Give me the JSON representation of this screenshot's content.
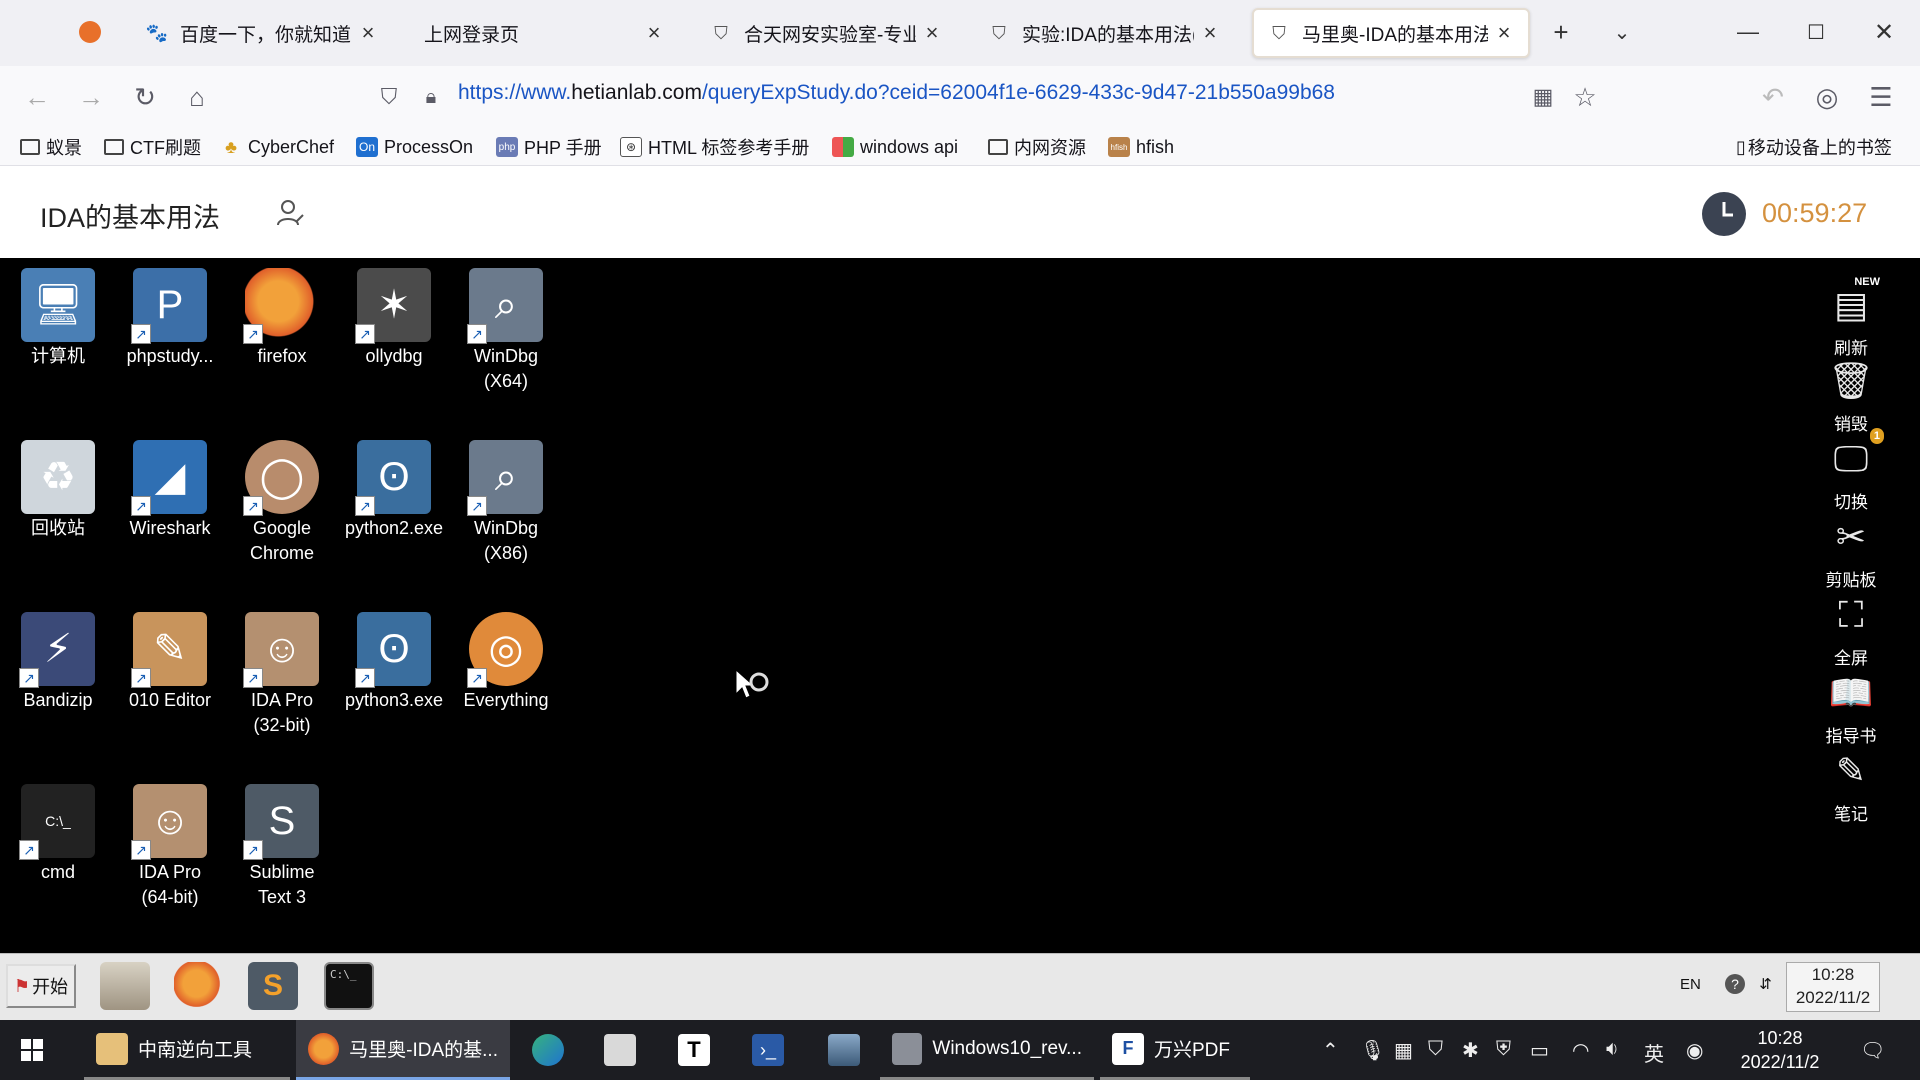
{
  "browser": {
    "tabs": [
      {
        "title": "百度一下，你就知道",
        "icon": "paw-icon"
      },
      {
        "title": "上网登录页",
        "icon": "none"
      },
      {
        "title": "合天网安实验室-专业提",
        "icon": "shield-icon"
      },
      {
        "title": "实验:IDA的基本用法(合天",
        "icon": "shield-icon"
      },
      {
        "title": "马里奥-IDA的基本用法",
        "icon": "shield-icon"
      }
    ],
    "url_base": "https://www.",
    "url_host": "hetianlab.com",
    "url_path": "/queryExpStudy.do?ceid=62004f1e-6629-433c-9d47-21b550a99b68",
    "bookmarks": [
      "蚁景",
      "CTF刷题",
      "CyberChef",
      "ProcessOn",
      "PHP 手册",
      "HTML 标签参考手册",
      "windows api",
      "内网资源",
      "hfish"
    ],
    "mobile_bookmarks": "移动设备上的书签"
  },
  "lab": {
    "title": "IDA的基本用法",
    "timer": "00:59:27"
  },
  "desktop": {
    "icons": [
      {
        "label": "计算机",
        "icon": "computer-icon",
        "color": "#4a7fb5"
      },
      {
        "label": "phpstudy...",
        "icon": "phpstudy-icon",
        "color": "#3c6fa8"
      },
      {
        "label": "firefox",
        "icon": "firefox-icon",
        "color": "#e8702a"
      },
      {
        "label": "ollydbg",
        "icon": "ollydbg-icon",
        "color": "#4b4b4b"
      },
      {
        "label": "WinDbg\n(X64)",
        "icon": "windbg-icon",
        "color": "#6b7a8c"
      },
      {
        "label": "回收站",
        "icon": "recycle-bin-icon",
        "color": "#cfd6dc"
      },
      {
        "label": "Wireshark",
        "icon": "wireshark-icon",
        "color": "#2f6fb3"
      },
      {
        "label": "Google\nChrome",
        "icon": "chrome-icon",
        "color": "#b88c6c"
      },
      {
        "label": "python2.exe",
        "icon": "python-icon",
        "color": "#3a6e9e"
      },
      {
        "label": "WinDbg\n(X86)",
        "icon": "windbg-icon",
        "color": "#6b7a8c"
      },
      {
        "label": "Bandizip",
        "icon": "bandizip-icon",
        "color": "#3b4a78"
      },
      {
        "label": "010 Editor",
        "icon": "010-editor-icon",
        "color": "#c8945c"
      },
      {
        "label": "IDA Pro\n(32-bit)",
        "icon": "ida-icon",
        "color": "#b49070"
      },
      {
        "label": "python3.exe",
        "icon": "python-icon",
        "color": "#3a6e9e"
      },
      {
        "label": "Everything",
        "icon": "everything-icon",
        "color": "#e08a3a"
      },
      {
        "label": "cmd",
        "icon": "cmd-icon",
        "color": "#222"
      },
      {
        "label": "IDA Pro\n(64-bit)",
        "icon": "ida-icon",
        "color": "#b49070"
      },
      {
        "label": "Sublime\nText 3",
        "icon": "sublime-icon",
        "color": "#4e5a66"
      }
    ],
    "right_tools": [
      {
        "label": "刷新",
        "icon": "refresh-icon",
        "glyph": "▤",
        "badge": "NEW"
      },
      {
        "label": "销毁",
        "icon": "trash-icon",
        "glyph": "🗑"
      },
      {
        "label": "切换",
        "icon": "monitor-icon",
        "glyph": "🖵",
        "badge": "1"
      },
      {
        "label": "剪贴板",
        "icon": "scissors-icon",
        "glyph": "✂"
      },
      {
        "label": "全屏",
        "icon": "fullscreen-icon",
        "glyph": "⛶"
      },
      {
        "label": "指导书",
        "icon": "book-icon",
        "glyph": "📖"
      },
      {
        "label": "笔记",
        "icon": "pencil-icon",
        "glyph": "✎"
      }
    ],
    "taskbar": {
      "start": "开始",
      "lang": "EN",
      "time": "10:28",
      "date": "2022/11/2"
    }
  },
  "host_taskbar": {
    "items": [
      "中南逆向工具",
      "马里奥-IDA的基...",
      "",
      "",
      "",
      "",
      "",
      "Windows10_rev...",
      "万兴PDF"
    ],
    "lang": "英",
    "time": "10:28",
    "date": "2022/11/2"
  }
}
